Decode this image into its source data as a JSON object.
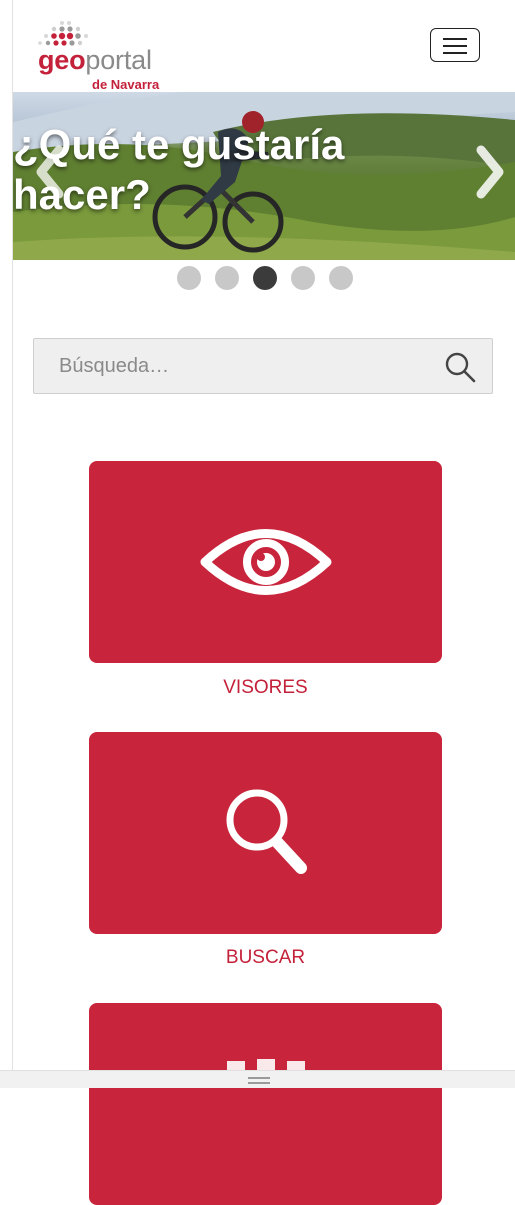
{
  "header": {
    "logo": {
      "geo": "geo",
      "portal": "portal",
      "subtitle": "de Navarra"
    },
    "menu_icon": "hamburger-icon"
  },
  "carousel": {
    "caption": "¿Qué te gustaría\nhacer?",
    "prev_icon": "chevron-left-icon",
    "next_icon": "chevron-right-icon",
    "slide_count": 5,
    "active_index": 3
  },
  "search": {
    "placeholder": "Búsqueda…",
    "icon": "search-icon"
  },
  "tiles": [
    {
      "label": "VISORES",
      "icon": "eye-icon"
    },
    {
      "label": "BUSCAR",
      "icon": "magnifier-icon"
    },
    {
      "label": "",
      "icon": "grid-icon"
    }
  ],
  "colors": {
    "brand_red": "#c8243b",
    "dot_inactive": "#c8c8c8",
    "dot_active": "#3b3b3b"
  }
}
